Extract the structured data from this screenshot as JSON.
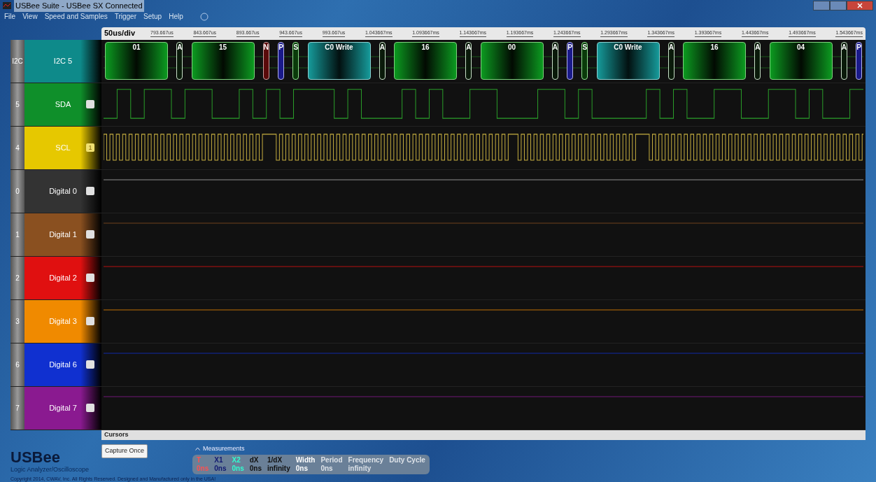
{
  "window": {
    "title": "USBee Suite - USBee SX Connected"
  },
  "menu": [
    "File",
    "View",
    "Speed and Samples",
    "Trigger",
    "Setup",
    "Help"
  ],
  "timeline": {
    "scale": "50us/div",
    "ticks": [
      "793.667us",
      "843.667us",
      "893.667us",
      "943.667us",
      "993.667us",
      "1.043667ms",
      "1.093667ms",
      "1.143667ms",
      "1.193667ms",
      "1.243667ms",
      "1.293667ms",
      "1.343667ms",
      "1.393667ms",
      "1.443667ms",
      "1.493667ms",
      "1.543667ms"
    ]
  },
  "channels": [
    {
      "kind": "decoder",
      "number": "I2C",
      "name": "I2C 5",
      "color": "#0e8a8a"
    },
    {
      "kind": "sda",
      "number": "5",
      "name": "SDA",
      "color": "#0f8f2a",
      "checked": false
    },
    {
      "kind": "scl",
      "number": "4",
      "name": "SCL",
      "color": "#e6c800",
      "checked": true,
      "trigger": "1"
    },
    {
      "kind": "flat",
      "number": "0",
      "name": "Digital 0",
      "color": "#333333",
      "checked": false
    },
    {
      "kind": "flat",
      "number": "1",
      "name": "Digital 1",
      "color": "#8a5020",
      "checked": false
    },
    {
      "kind": "flat",
      "number": "2",
      "name": "Digital 2",
      "color": "#e01010",
      "checked": false
    },
    {
      "kind": "flat",
      "number": "3",
      "name": "Digital 3",
      "color": "#f08a00",
      "checked": false
    },
    {
      "kind": "flat",
      "number": "6",
      "name": "Digital 6",
      "color": "#1030d0",
      "checked": false
    },
    {
      "kind": "flat",
      "number": "7",
      "name": "Digital 7",
      "color": "#8a1a90",
      "checked": false
    }
  ],
  "packets": [
    {
      "kind": "data",
      "label": "01"
    },
    {
      "kind": "ack",
      "label": "A"
    },
    {
      "kind": "data",
      "label": "15"
    },
    {
      "kind": "nack",
      "label": "N"
    },
    {
      "kind": "stop",
      "label": "P"
    },
    {
      "kind": "start",
      "label": "S"
    },
    {
      "kind": "address",
      "label": "C0 Write"
    },
    {
      "kind": "ack",
      "label": "A"
    },
    {
      "kind": "data",
      "label": "16"
    },
    {
      "kind": "ack",
      "label": "A"
    },
    {
      "kind": "data",
      "label": "00"
    },
    {
      "kind": "ack",
      "label": "A"
    },
    {
      "kind": "stop",
      "label": "P"
    },
    {
      "kind": "start",
      "label": "S"
    },
    {
      "kind": "address",
      "label": "C0 Write"
    },
    {
      "kind": "ack",
      "label": "A"
    },
    {
      "kind": "data",
      "label": "16"
    },
    {
      "kind": "ack",
      "label": "A"
    },
    {
      "kind": "data",
      "label": "04"
    },
    {
      "kind": "ack",
      "label": "A"
    },
    {
      "kind": "stop",
      "label": "P"
    }
  ],
  "cursors_title": "Cursors",
  "capture_button": "Capture Once",
  "measurements": {
    "title": "Measurements",
    "items": [
      {
        "label": "T",
        "value": "0ns",
        "color": "#ff5050"
      },
      {
        "label": "X1",
        "value": "0ns",
        "color": "#101870"
      },
      {
        "label": "X2",
        "value": "0ns",
        "color": "#30ffd0"
      },
      {
        "label": "dX",
        "value": "0ns",
        "color": "#101010"
      },
      {
        "label": "1/dX",
        "value": "infinity",
        "color": "#101010"
      },
      {
        "label": "Width",
        "value": "0ns",
        "color": "#ffffff"
      },
      {
        "label": "Period",
        "value": "0ns",
        "color": "#dde2e8"
      },
      {
        "label": "Frequency",
        "value": "infinity",
        "color": "#dde2e8"
      },
      {
        "label": "Duty Cycle",
        "color": "#dde2e8"
      }
    ]
  },
  "logo": {
    "name": "USBee",
    "subtitle": "Logic Analyzer/Oscilloscope",
    "copyright": "Copyright 2014, CWAV, Inc. All Rights Reserved. Designed and Manufactured only in the USA!"
  }
}
